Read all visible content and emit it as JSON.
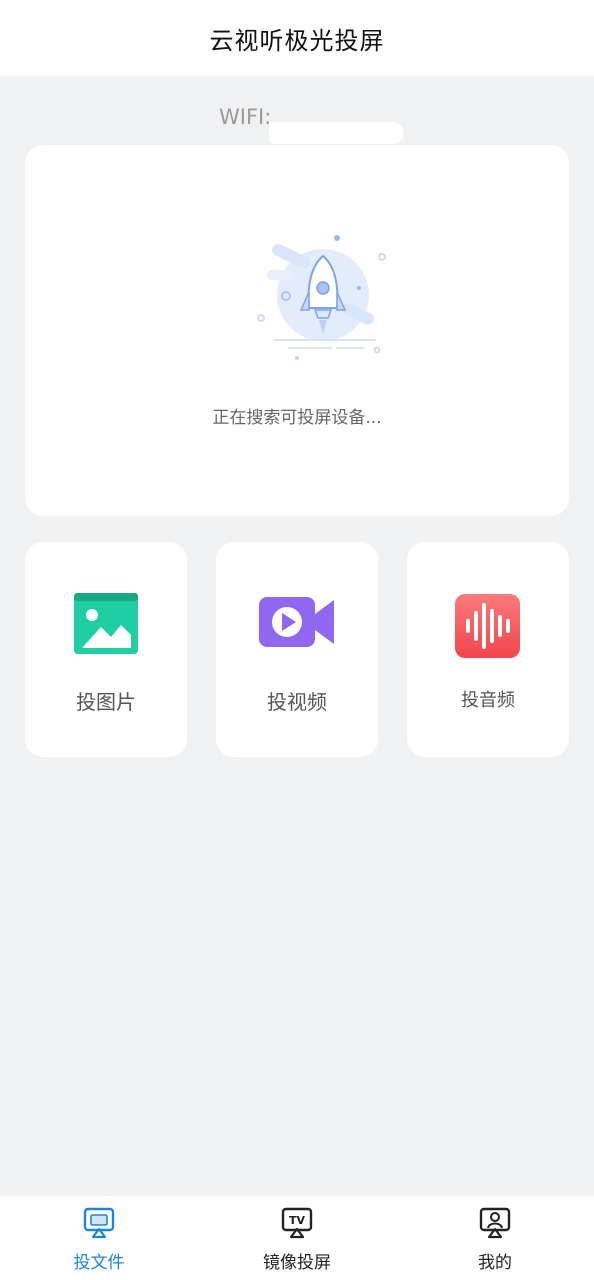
{
  "header": {
    "title": "云视听极光投屏"
  },
  "wifi": {
    "label": "WIFI:"
  },
  "search": {
    "status": "正在搜索可投屏设备..."
  },
  "tiles": [
    {
      "label": "投图片",
      "icon": "image-icon",
      "color": "#1fcfa3"
    },
    {
      "label": "投视频",
      "icon": "video-camera-icon",
      "color": "#8f67f0"
    },
    {
      "label": "投音频",
      "icon": "audio-wave-icon",
      "color": "#f75a5e"
    }
  ],
  "tabs": [
    {
      "label": "投文件",
      "icon": "cast-file-icon",
      "active": true
    },
    {
      "label": "镜像投屏",
      "icon": "tv-mirror-icon",
      "active": false
    },
    {
      "label": "我的",
      "icon": "profile-icon",
      "active": false
    }
  ],
  "colors": {
    "accent": "#1f86d6",
    "background": "#f0f1f3"
  }
}
